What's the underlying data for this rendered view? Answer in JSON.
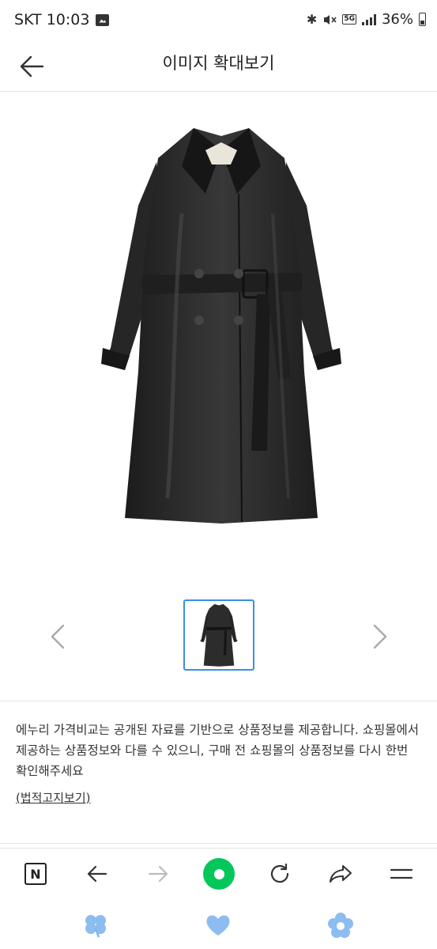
{
  "status_bar": {
    "carrier_time": "SKT 10:03",
    "bluetooth_glyph": "✱",
    "mute_glyph": "🔇",
    "network_badge": "5G",
    "battery": "36%"
  },
  "header": {
    "title": "이미지 확대보기",
    "back_icon": "arrow-left-icon"
  },
  "main_image": {
    "subject": "black leather trench coat",
    "colors": {
      "coat": "#2b2b2b",
      "coat_dark": "#151515",
      "coat_highlight": "#4a4a4a"
    }
  },
  "gallery": {
    "prev_icon": "chevron-left-icon",
    "next_icon": "chevron-right-icon",
    "selected_border_color": "#3a8ee6"
  },
  "notice": {
    "text": "에누리 가격비교는 공개된 자료를 기반으로 상품정보를 제공합니다. 쇼핑몰에서 제공하는 상품정보와 다를 수 있으니, 구매 전 쇼핑몰의 상품정보를 다시 한번 확인해주세요",
    "legal_link": "(법적고지보기)"
  },
  "nav_bar": {
    "home_letter": "N",
    "accent_color": "#03c75a",
    "items": [
      "naver-home-icon",
      "back-icon",
      "forward-icon",
      "green-dot-icon",
      "refresh-icon",
      "share-icon",
      "menu-icon"
    ]
  },
  "gesture_row": {
    "items": [
      "clover-icon",
      "heart-icon",
      "flower-icon"
    ],
    "color": "#7fb3ea"
  }
}
